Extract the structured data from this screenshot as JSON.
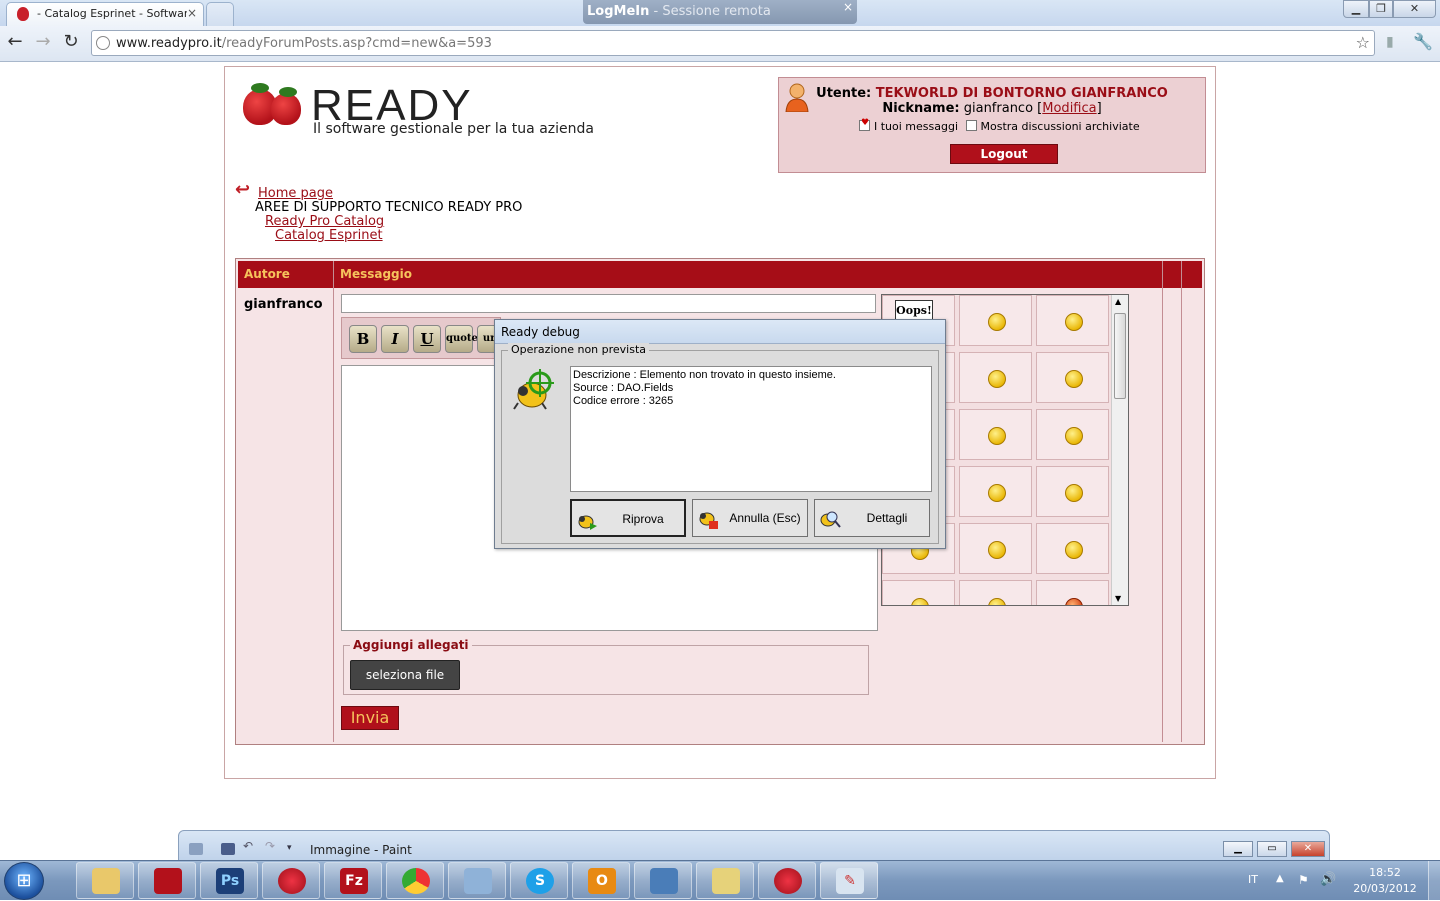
{
  "browser": {
    "tab_title": "- Catalog Esprinet - Softwar",
    "tab_close": "×",
    "logmein_brand": "LogMeIn",
    "logmein_subtitle": "- Sessione remota",
    "logmein_close": "×",
    "url_host": "www.readypro.it",
    "url_path": "/readyForumPosts.asp?cmd=new&a=593"
  },
  "logo": {
    "wordmark": "READY",
    "tagline": "Il software gestionale per la tua azienda"
  },
  "user": {
    "label": "Utente:",
    "name": "TEKWORLD DI BONTORNO GIANFRANCO",
    "nickname_label": "Nickname:",
    "nickname": "gianfranco",
    "edit_link": "Modifica",
    "my_messages": "I tuoi messaggi",
    "show_archived": "Mostra discussioni archiviate",
    "logout": "Logout"
  },
  "breadcrumb": {
    "home": "Home page",
    "area": "AREE DI SUPPORTO TECNICO READY PRO",
    "category": "Ready Pro Catalog",
    "subcategory": "Catalog Esprinet"
  },
  "forum": {
    "col_author": "Autore",
    "col_message": "Messaggio",
    "author": "gianfranco",
    "fmt_bold": "B",
    "fmt_italic": "I",
    "fmt_underline": "U",
    "fmt_quote": "quote",
    "fmt_url": "url",
    "oops": "Oops!",
    "attach_legend": "Aggiungi allegati",
    "select_file": "seleziona file",
    "send": "Invia"
  },
  "dialog": {
    "title": "Ready debug",
    "group": "Operazione non prevista",
    "line1": "Descrizione : Elemento non trovato in questo insieme.",
    "line2": "Source : DAO.Fields",
    "line3": "Codice errore : 3265",
    "btn_retry": "Riprova",
    "btn_cancel": "Annulla (Esc)",
    "btn_details": "Dettagli"
  },
  "paint": {
    "title": "Immagine - Paint"
  },
  "taskbar": {
    "lang": "IT",
    "time": "18:52",
    "date": "20/03/2012"
  },
  "colors": {
    "brand_red": "#a60d17",
    "header_text": "#f6c35c",
    "panel_pink": "#f6e4e6"
  }
}
